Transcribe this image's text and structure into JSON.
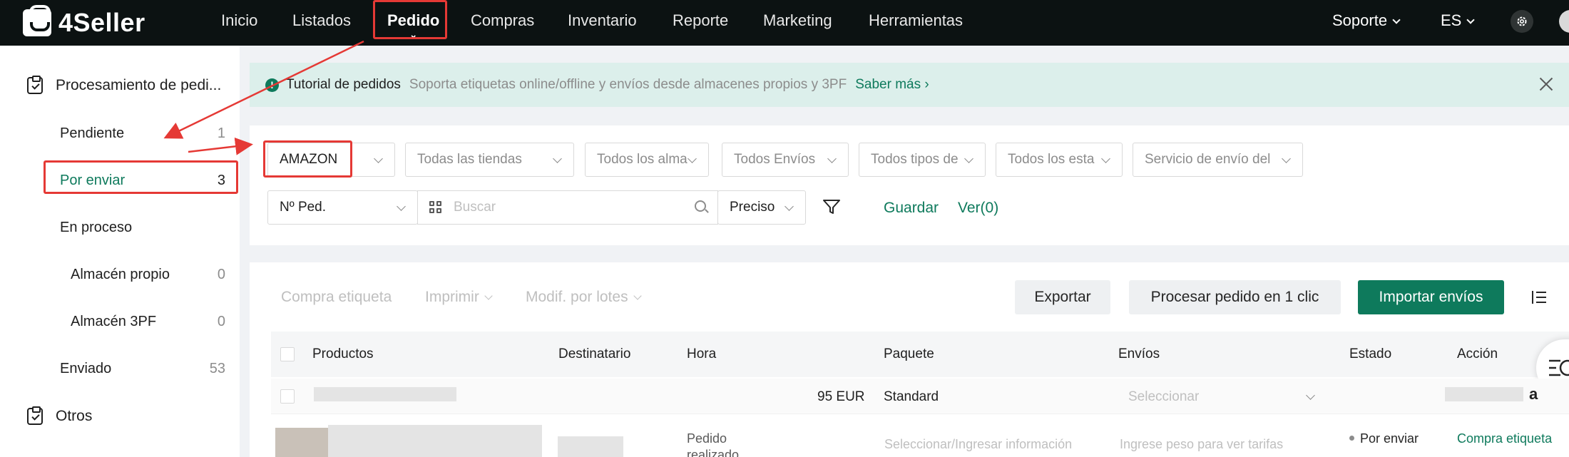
{
  "brand": {
    "name": "4Seller"
  },
  "nav": {
    "items": [
      "Inicio",
      "Listados",
      "Pedido",
      "Compras",
      "Inventario",
      "Reporte",
      "Marketing",
      "Herramientas"
    ],
    "active": "Pedido",
    "support": "Soporte",
    "language": "ES"
  },
  "sidebar": {
    "group1": "Procesamiento de pedi...",
    "items": [
      {
        "label": "Pendiente",
        "count": "1"
      },
      {
        "label": "Por enviar",
        "count": "3"
      },
      {
        "label": "En proceso",
        "count": ""
      },
      {
        "label": "Almacén propio",
        "count": "0"
      },
      {
        "label": "Almacén 3PF",
        "count": "0"
      },
      {
        "label": "Enviado",
        "count": "53"
      }
    ],
    "group2": "Otros"
  },
  "banner": {
    "title": "Tutorial de pedidos",
    "desc": "Soporta etiquetas online/offline y envíos desde almacenes propios y 3PF",
    "link": "Saber más"
  },
  "filters": {
    "platform": "AMAZON",
    "stores": "Todas las tiendas",
    "warehouses": "Todos los alma",
    "shipping": "Todos Envíos",
    "types": "Todos tipos de",
    "states": "Todos los esta",
    "service": "Servicio de envío del",
    "field": "Nº Ped.",
    "search_placeholder": "Buscar",
    "match": "Preciso",
    "save": "Guardar",
    "view": "Ver(0)"
  },
  "toolbar": {
    "buy_label": "Compra etiqueta",
    "print": "Imprimir",
    "batch_edit": "Modif. por lotes",
    "export": "Exportar",
    "process_one_click": "Procesar pedido en 1 clic",
    "import": "Importar envíos"
  },
  "table": {
    "headers": [
      "Productos",
      "Destinatario",
      "Hora",
      "Paquete",
      "Envíos",
      "Estado",
      "Acción"
    ],
    "row1": {
      "amount": "95 EUR",
      "package": "Standard",
      "shipping_placeholder": "Seleccionar",
      "platform_glyph": "a"
    },
    "row2": {
      "time_line1": "Pedido",
      "time_line2": "realizado",
      "package_placeholder": "Seleccionar/Ingresar información",
      "shipping_hint": "Ingrese peso para ver tarifas",
      "status": "Por enviar",
      "action": "Compra etiqueta"
    }
  },
  "colors": {
    "brand_green": "#0e7a5c",
    "nav_bg": "#0c1212",
    "annotation_red": "#e53935"
  }
}
